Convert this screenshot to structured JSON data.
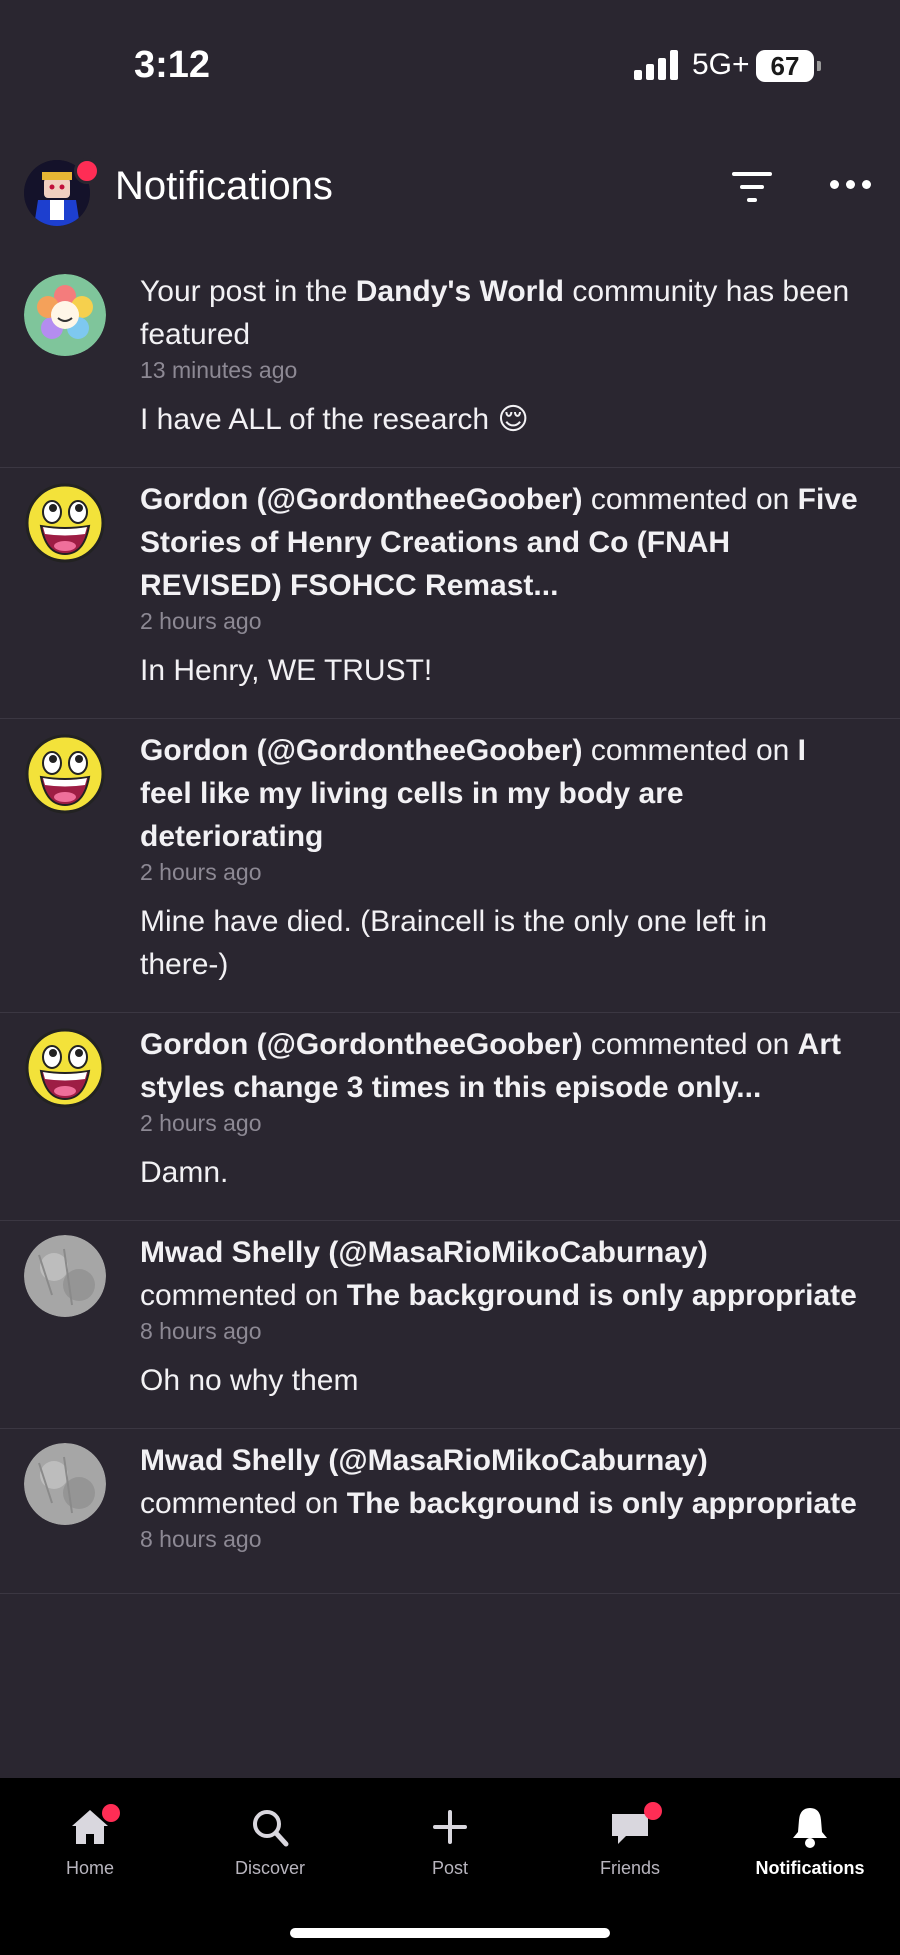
{
  "status": {
    "time": "3:12",
    "network": "5G+",
    "battery": "67"
  },
  "header": {
    "title": "Notifications"
  },
  "notifications": [
    {
      "avatar": "flower-icon",
      "text_a": "Your post in the ",
      "bold_a": "Dandy's World",
      "text_b": " community has been featured",
      "time": "13 minutes ago",
      "preview": "I have ALL of the research 😌"
    },
    {
      "avatar": "awesome-face-icon",
      "user": "Gordon (@GordontheeGoober)",
      "action": " commented on ",
      "target": "Five Stories of Henry Creations and Co (FNAH REVISED) FSOHCC Remast...",
      "time": "2 hours ago",
      "preview": "In Henry, WE TRUST!"
    },
    {
      "avatar": "awesome-face-icon",
      "user": "Gordon (@GordontheeGoober)",
      "action": " commented on ",
      "target": "I feel like my living cells in my body are deteriorating",
      "time": "2 hours ago",
      "preview": "Mine have died. (Braincell is the only one left in there-)"
    },
    {
      "avatar": "awesome-face-icon",
      "user": "Gordon (@GordontheeGoober)",
      "action": " commented on ",
      "target": "Art styles change 3 times in this episode only...",
      "time": "2 hours ago",
      "preview": "Damn."
    },
    {
      "avatar": "gray-photo-avatar",
      "user": "Mwad Shelly (@MasaRioMikoCaburnay)",
      "action": " commented on ",
      "target": "The background is only appropriate",
      "time": "8 hours ago",
      "preview": "Oh no why them"
    },
    {
      "avatar": "gray-photo-avatar",
      "user": "Mwad Shelly (@MasaRioMikoCaburnay)",
      "action": " commented on ",
      "target": "The background is only appropriate",
      "time": "8 hours ago",
      "preview": ""
    }
  ],
  "tabs": [
    {
      "label": "Home",
      "icon": "home-icon",
      "badge": true
    },
    {
      "label": "Discover",
      "icon": "search-icon",
      "badge": false
    },
    {
      "label": "Post",
      "icon": "plus-icon",
      "badge": false
    },
    {
      "label": "Friends",
      "icon": "chat-icon",
      "badge": true
    },
    {
      "label": "Notifications",
      "icon": "bell-icon",
      "badge": false,
      "active": true
    }
  ],
  "colors": {
    "background": "#2a2630",
    "badge": "#ff2d55",
    "tabbar": "#000000",
    "muted_text": "#8d8994"
  }
}
